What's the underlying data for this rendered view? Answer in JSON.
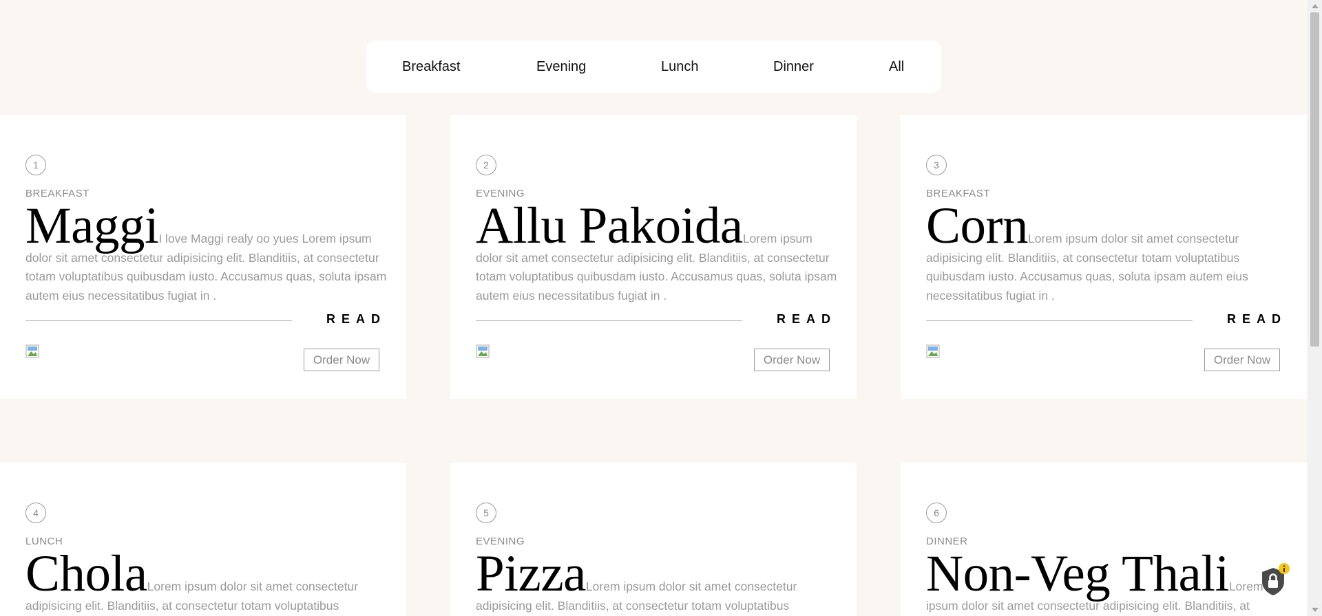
{
  "nav": {
    "items": [
      "Breakfast",
      "Evening",
      "Lunch",
      "Dinner",
      "All"
    ]
  },
  "cards": [
    {
      "number": "1",
      "category": "BREAKFAST",
      "title": "Maggi",
      "description": "I love Maggi realy oo yues Lorem ipsum dolor sit amet consectetur adipisicing elit. Blanditiis, at consectetur totam voluptatibus quibusdam iusto. Accusamus quas, soluta ipsam autem eius necessitatibus fugiat in .",
      "read_label": "READ",
      "order_label": "Order Now"
    },
    {
      "number": "2",
      "category": "EVENING",
      "title": "Allu Pakoida",
      "description": "Lorem ipsum dolor sit amet consectetur adipisicing elit. Blanditiis, at consectetur totam voluptatibus quibusdam iusto. Accusamus quas, soluta ipsam autem eius necessitatibus fugiat in .",
      "read_label": "READ",
      "order_label": "Order Now"
    },
    {
      "number": "3",
      "category": "BREAKFAST",
      "title": "Corn",
      "description": "Lorem ipsum dolor sit amet consectetur adipisicing elit. Blanditiis, at consectetur totam voluptatibus quibusdam iusto. Accusamus quas, soluta ipsam autem eius necessitatibus fugiat in .",
      "read_label": "READ",
      "order_label": "Order Now"
    },
    {
      "number": "4",
      "category": "LUNCH",
      "title": "Chola",
      "description": "Lorem ipsum dolor sit amet consectetur adipisicing elit. Blanditiis, at consectetur totam voluptatibus"
    },
    {
      "number": "5",
      "category": "EVENING",
      "title": "Pizza",
      "description": "Lorem ipsum dolor sit amet consectetur adipisicing elit. Blanditiis, at consectetur totam voluptatibus"
    },
    {
      "number": "6",
      "category": "DINNER",
      "title": "Non-Veg Thali",
      "description": "Lorem ipsum dolor sit amet consectetur adipisicing elit. Blanditiis, at"
    }
  ],
  "colors": {
    "page_background": "#faf7f3",
    "card_background": "#ffffff",
    "muted_text": "#9a9a9a",
    "title_text": "#000000",
    "rule": "#b4b6cc"
  },
  "icons": {
    "privacy_badge": "lock-shield-icon",
    "broken_image": "broken-image-icon"
  }
}
